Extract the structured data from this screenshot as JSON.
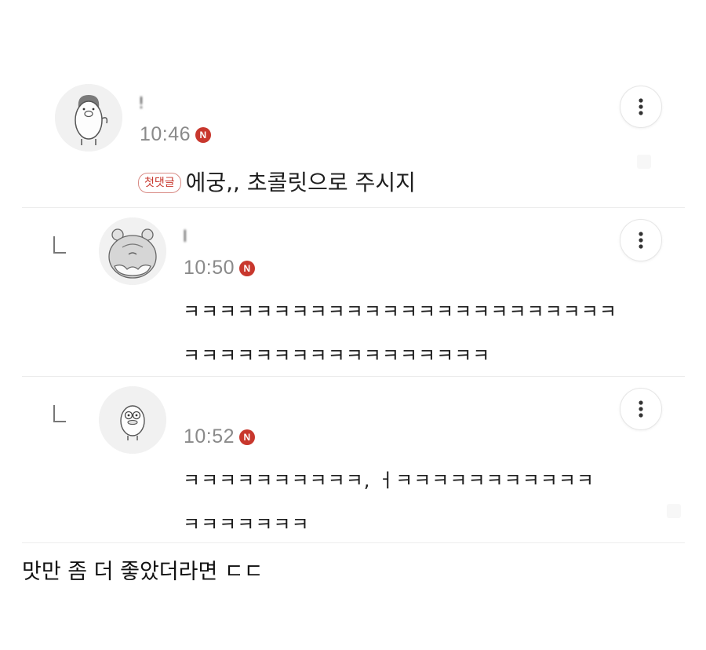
{
  "comments": [
    {
      "author": "!",
      "time": "10:46",
      "new_badge": "N",
      "first_comment_badge": "첫댓글",
      "lines": [
        "에궁,, 초콜릿으로 주시지"
      ],
      "avatar_icon": "pig-character-icon"
    },
    {
      "author": "l",
      "time": "10:50",
      "new_badge": "N",
      "lines": [
        "ㅋㅋㅋㅋㅋㅋㅋㅋㅋㅋㅋㅋㅋㅋㅋㅋㅋㅋㅋㅋㅋㅋㅋㅋ",
        "ㅋㅋㅋㅋㅋㅋㅋㅋㅋㅋㅋㅋㅋㅋㅋㅋㅋ"
      ],
      "avatar_icon": "hamster-character-icon"
    },
    {
      "author": "",
      "time": "10:52",
      "new_badge": "N",
      "lines": [
        "ㅋㅋㅋㅋㅋㅋㅋㅋㅋㅋ,  ㅓㅋㅋㅋㅋㅋㅋㅋㅋㅋㅋㅋ",
        "ㅋㅋㅋㅋㅋㅋㅋ"
      ],
      "avatar_icon": "duck-character-icon"
    }
  ],
  "caption": "맛만 좀 더 좋았더라면 ㄷㄷ",
  "colors": {
    "badge_red": "#c8372d",
    "time_gray": "#8a8a8a",
    "divider": "#ececec"
  }
}
